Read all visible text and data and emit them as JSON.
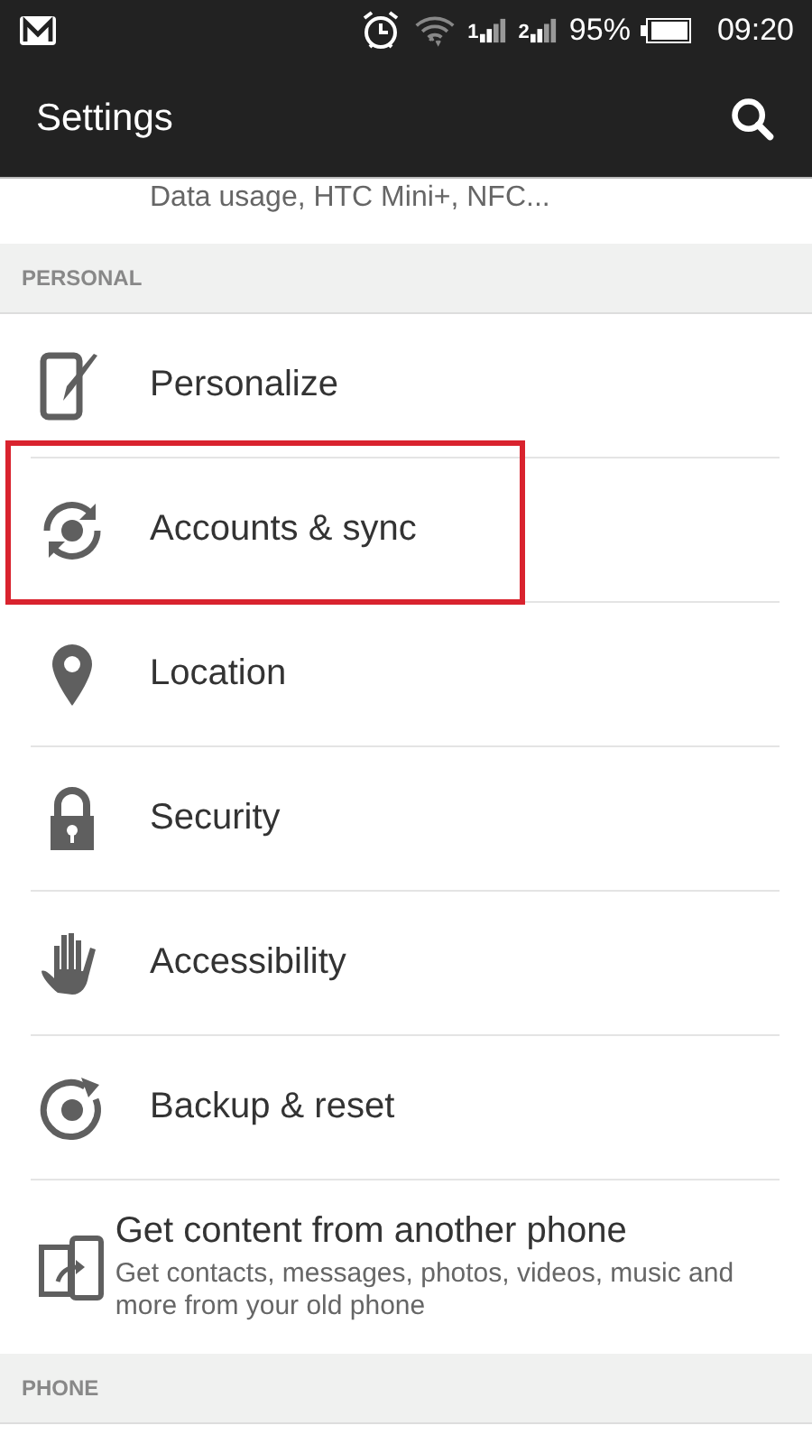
{
  "status_bar": {
    "signals": [
      {
        "label": "1"
      },
      {
        "label": "2"
      }
    ],
    "battery_text": "95%",
    "time": "09:20"
  },
  "app_bar": {
    "title": "Settings"
  },
  "partial_row": {
    "summary": "Data usage, HTC Mini+, NFC..."
  },
  "sections": [
    {
      "header": "PERSONAL",
      "items": [
        {
          "kind": "personalize",
          "title": "Personalize",
          "highlighted": false
        },
        {
          "kind": "sync",
          "title": "Accounts & sync",
          "highlighted": true
        },
        {
          "kind": "location",
          "title": "Location",
          "highlighted": false
        },
        {
          "kind": "security",
          "title": "Security",
          "highlighted": false
        },
        {
          "kind": "accessibility",
          "title": "Accessibility",
          "highlighted": false
        },
        {
          "kind": "backup",
          "title": "Backup & reset",
          "highlighted": false
        },
        {
          "kind": "transfer",
          "title": "Get content from another phone",
          "summary": "Get contacts, messages, photos, videos, music and more from your old phone",
          "highlighted": false
        }
      ]
    },
    {
      "header": "PHONE"
    }
  ]
}
